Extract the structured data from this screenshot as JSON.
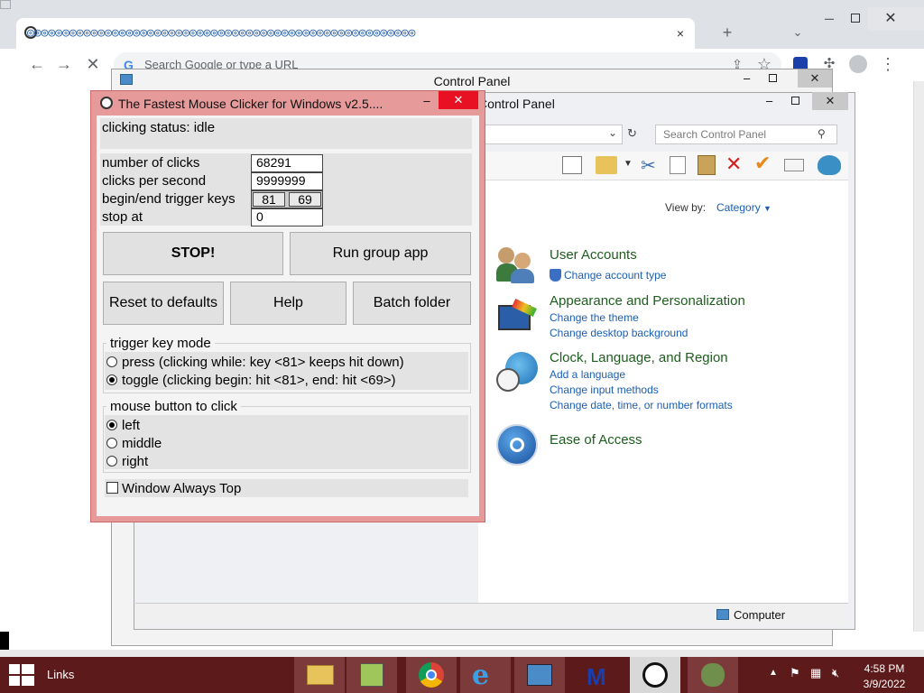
{
  "chrome": {
    "tab_title": "◎◎◎◎◎◎◎◎◎◎◎◎◎◎◎◎◎◎◎◎◎◎◎◎◎◎◎◎◎◎◎◎◎◎◎◎◎◎◎◎◎◎◎◎◎◎◎◎◎◎◎◎◎◎◎",
    "new_tab": "+",
    "omnibox_placeholder": "Search Google or type a URL"
  },
  "control_panel_back": {
    "title": "Control Panel"
  },
  "control_panel": {
    "title": "Control Panel",
    "search_placeholder": "Search Control Panel",
    "view_by_label": "View by:",
    "view_by_value": "Category",
    "categories": [
      {
        "heading": "User Accounts",
        "links": [
          "Change account type"
        ]
      },
      {
        "heading": "Appearance and Personalization",
        "links": [
          "Change the theme",
          "Change desktop background"
        ]
      },
      {
        "heading": "Clock, Language, and Region",
        "links": [
          "Add a language",
          "Change input methods",
          "Change date, time, or number formats"
        ]
      },
      {
        "heading": "Ease of Access",
        "links": []
      }
    ],
    "status_bar": "Computer"
  },
  "mouse_clicker": {
    "title": "The Fastest Mouse Clicker for Windows v2.5....",
    "status": "clicking status: idle",
    "labels": {
      "clicks": "number of clicks",
      "cps": "clicks per second",
      "trigger_keys": "begin/end trigger keys",
      "stop_at": "stop at"
    },
    "values": {
      "clicks": "68291",
      "cps": "9999999",
      "begin_key": "81",
      "end_key": "69",
      "stop_at": "0"
    },
    "buttons": {
      "stop": "STOP!",
      "run_group": "Run group app",
      "reset": "Reset to defaults",
      "help": "Help",
      "batch_folder": "Batch folder"
    },
    "trigger_mode": {
      "legend": "trigger key mode",
      "press": "press (clicking while: key <81> keeps hit down)",
      "toggle": "toggle (clicking begin: hit <81>, end: hit <69>)",
      "selected": "toggle"
    },
    "mouse_button": {
      "legend": "mouse button to click",
      "left": "left",
      "middle": "middle",
      "right": "right",
      "selected": "left"
    },
    "always_top": "Window Always Top"
  },
  "taskbar": {
    "links_label": "Links",
    "time": "4:58 PM",
    "date": "3/9/2022"
  },
  "colors": {
    "clicker_frame": "#e79a9a",
    "close_red": "#e81123",
    "taskbar": "#5c1a1a",
    "cp_link": "#1a5fb4",
    "cp_heading": "#1e5d1e"
  }
}
